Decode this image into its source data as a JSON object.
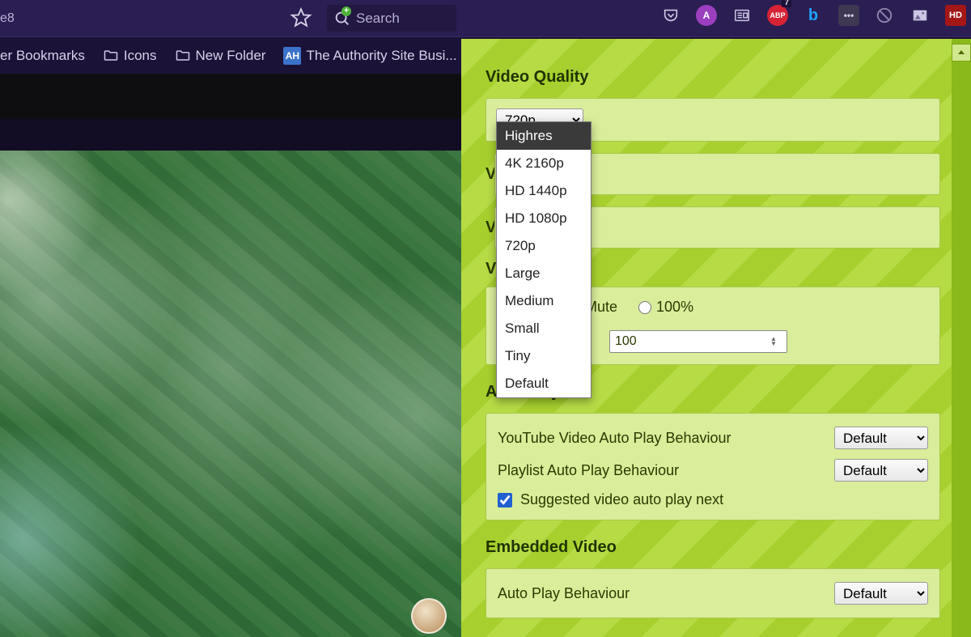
{
  "chrome": {
    "address_fragment": "e8",
    "search_placeholder": "Search",
    "ext_badge_abp": "ABP",
    "ext_badge_abp_count": "7",
    "ext_badge_hd": "HD"
  },
  "bookmarks": {
    "item0": "er Bookmarks",
    "item1": "Icons",
    "item2": "New Folder",
    "item3_prefix": "AH",
    "item3": "The Authority Site Busi..."
  },
  "panel": {
    "quality_title": "Video Quality",
    "quality_selected": "720p",
    "quality_options": {
      "o0": "Highres",
      "o1": "4K 2160p",
      "o2": "HD 1440p",
      "o3": "HD 1080p",
      "o4": "720p",
      "o5": "Large",
      "o6": "Medium",
      "o7": "Small",
      "o8": "Tiny",
      "o9": "Default"
    },
    "hidden_label_prefix": "V",
    "volume_mute_label": "Mute",
    "volume_100_label": "100%",
    "volume_value": "100",
    "autoplay_title": "Auto Play",
    "autoplay_row1_label": "YouTube Video Auto Play Behaviour",
    "autoplay_row1_value": "Default",
    "autoplay_row2_label": "Playlist Auto Play Behaviour",
    "autoplay_row2_value": "Default",
    "autoplay_checkbox_label": "Suggested video auto play next",
    "embedded_title": "Embedded Video",
    "embedded_row1_label": "Auto Play Behaviour",
    "embedded_row1_value": "Default"
  }
}
